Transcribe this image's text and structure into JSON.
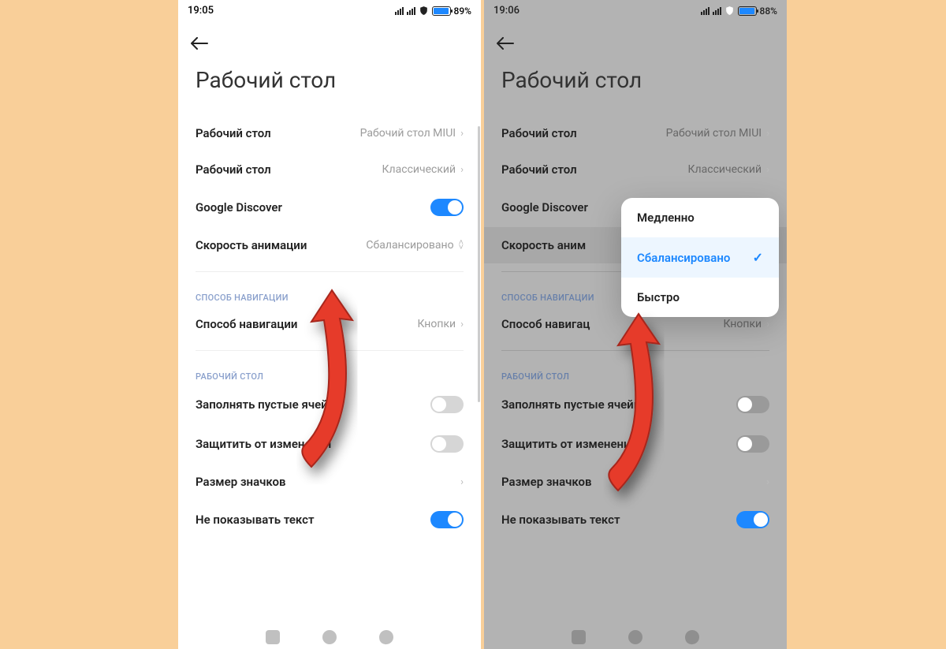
{
  "left": {
    "status_time": "19:05",
    "battery_pct": "89%",
    "page_title": "Рабочий стол",
    "rows": {
      "home1_label": "Рабочий стол",
      "home1_value": "Рабочий стол MIUI",
      "home2_label": "Рабочий стол",
      "home2_value": "Классический",
      "discover_label": "Google Discover",
      "speed_label": "Скорость анимации",
      "speed_value": "Сбалансировано",
      "nav_section": "СПОСОБ НАВИГАЦИИ",
      "nav_label": "Способ навигации",
      "nav_value": "Кнопки",
      "home_section": "РАБОЧИЙ СТОЛ",
      "fill_label": "Заполнять пустые ячейки",
      "lock_label": "Защитить от изменений",
      "iconsize_label": "Размер значков",
      "hidetext_label": "Не показывать текст"
    }
  },
  "right": {
    "status_time": "19:06",
    "battery_pct": "88%",
    "page_title": "Рабочий стол",
    "rows": {
      "home1_label": "Рабочий стол",
      "home1_value": "Рабочий стол MIUI",
      "home2_label": "Рабочий стол",
      "home2_value": "Классический",
      "discover_label": "Google Discover",
      "speed_label": "Скорость аним",
      "nav_section": "СПОСОБ НАВИГАЦИИ",
      "nav_label": "Способ навигац",
      "nav_value": "Кнопки",
      "home_section": "РАБОЧИЙ СТОЛ",
      "fill_label": "Заполнять пустые ячейки",
      "lock_label": "Защитить от изменений",
      "iconsize_label": "Размер значков",
      "hidetext_label": "Не показывать текст"
    },
    "popup": {
      "opt1": "Медленно",
      "opt2": "Сбалансировано",
      "opt3": "Быстро"
    }
  }
}
